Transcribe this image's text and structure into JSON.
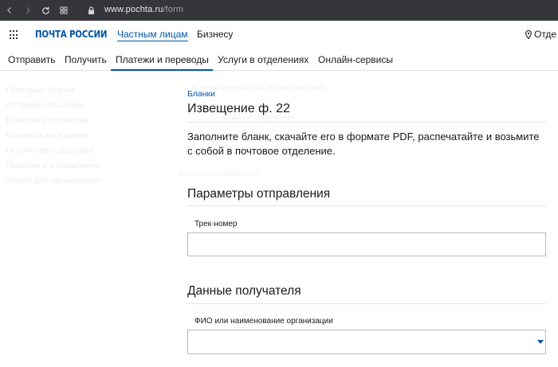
{
  "browser": {
    "url_host": "www.pochta.ru",
    "url_path": "/form"
  },
  "header": {
    "logo": "ПОЧТА РОССИИ",
    "links": [
      "Частным лицам",
      "Бизнесу"
    ],
    "location": "Отде"
  },
  "nav": {
    "items": [
      "Отправить",
      "Получить",
      "Платежи и переводы",
      "Услуги в отделениях",
      "Онлайн-сервисы"
    ],
    "active": "Платежи и переводы"
  },
  "sidebar": {
    "items": [
      "Почтовые бланки",
      "Отправка письмами",
      "Платежи и переводы",
      "Подписка на издания",
      "Получение и доставка",
      "Посылки и отправления",
      "Услуги для организаций"
    ]
  },
  "ghost_text": {
    "line1": "Бланки извещений и уведомлений",
    "line2": "Бланки получения",
    "line3": "Бланки отправления"
  },
  "form": {
    "breadcrumb": "Бланки",
    "title": "Извещение ф. 22",
    "intro": "Заполните бланк, скачайте его в формате PDF, распечатайте и возьмите с собой в почтовое отделение.",
    "section1_title": "Параметры отправления",
    "track_label": "Трек-номер",
    "track_value": "",
    "section2_title": "Данные получателя",
    "recipient_label": "ФИО или наименование организации",
    "recipient_value": ""
  },
  "colors": {
    "brand": "#0055a6",
    "browser_bar": "#35363a"
  }
}
